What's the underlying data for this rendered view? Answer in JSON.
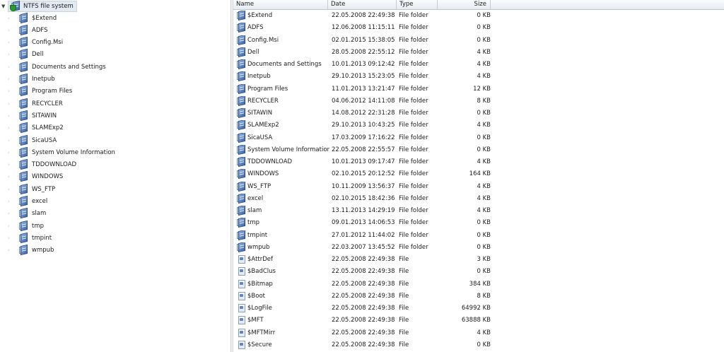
{
  "tree": {
    "root": {
      "label": "NTFS file system",
      "expander": "▼",
      "icon": "ntfs-drive-icon"
    },
    "items": [
      {
        "label": "$Extend"
      },
      {
        "label": "ADFS"
      },
      {
        "label": "Config.Msi"
      },
      {
        "label": "Dell"
      },
      {
        "label": "Documents and Settings"
      },
      {
        "label": "Inetpub"
      },
      {
        "label": "Program Files"
      },
      {
        "label": "RECYCLER"
      },
      {
        "label": "SITAWIN"
      },
      {
        "label": "SLAMExp2"
      },
      {
        "label": "SicaUSA"
      },
      {
        "label": "System Volume Information"
      },
      {
        "label": "TDDOWNLOAD"
      },
      {
        "label": "WINDOWS"
      },
      {
        "label": "WS_FTP"
      },
      {
        "label": "excel"
      },
      {
        "label": "slam"
      },
      {
        "label": "tmp"
      },
      {
        "label": "tmpint"
      },
      {
        "label": "wmpub"
      }
    ],
    "collapsed_expander": "›",
    "item_icon": "folder-drive-icon"
  },
  "list": {
    "columns": {
      "name": "Name",
      "date": "Date",
      "type": "Type",
      "size": "Size"
    },
    "rows": [
      {
        "name": "$Extend",
        "date": "22.05.2008 22:49:38",
        "type": "File folder",
        "size": "0 KB",
        "kind": "folder"
      },
      {
        "name": "ADFS",
        "date": "12.06.2008 11:15:11",
        "type": "File folder",
        "size": "0 KB",
        "kind": "folder"
      },
      {
        "name": "Config.Msi",
        "date": "02.01.2015 15:38:05",
        "type": "File folder",
        "size": "0 KB",
        "kind": "folder"
      },
      {
        "name": "Dell",
        "date": "28.05.2008 22:55:12",
        "type": "File folder",
        "size": "4 KB",
        "kind": "folder"
      },
      {
        "name": "Documents and Settings",
        "date": "10.01.2013 09:12:42",
        "type": "File folder",
        "size": "4 KB",
        "kind": "folder"
      },
      {
        "name": "Inetpub",
        "date": "29.10.2013 15:23:05",
        "type": "File folder",
        "size": "4 KB",
        "kind": "folder"
      },
      {
        "name": "Program Files",
        "date": "11.01.2013 13:21:47",
        "type": "File folder",
        "size": "12 KB",
        "kind": "folder"
      },
      {
        "name": "RECYCLER",
        "date": "04.06.2012 14:11:08",
        "type": "File folder",
        "size": "8 KB",
        "kind": "folder"
      },
      {
        "name": "SITAWIN",
        "date": "14.08.2012 22:31:28",
        "type": "File folder",
        "size": "0 KB",
        "kind": "folder"
      },
      {
        "name": "SLAMExp2",
        "date": "29.10.2013 10:43:25",
        "type": "File folder",
        "size": "4 KB",
        "kind": "folder"
      },
      {
        "name": "SicaUSA",
        "date": "17.03.2009 17:16:22",
        "type": "File folder",
        "size": "0 KB",
        "kind": "folder"
      },
      {
        "name": "System Volume Information",
        "date": "22.05.2008 22:55:57",
        "type": "File folder",
        "size": "0 KB",
        "kind": "folder"
      },
      {
        "name": "TDDOWNLOAD",
        "date": "10.01.2013 09:17:47",
        "type": "File folder",
        "size": "4 KB",
        "kind": "folder"
      },
      {
        "name": "WINDOWS",
        "date": "02.10.2015 20:12:52",
        "type": "File folder",
        "size": "164 KB",
        "kind": "folder"
      },
      {
        "name": "WS_FTP",
        "date": "10.11.2009 13:56:37",
        "type": "File folder",
        "size": "4 KB",
        "kind": "folder"
      },
      {
        "name": "excel",
        "date": "02.10.2015 18:42:36",
        "type": "File folder",
        "size": "4 KB",
        "kind": "folder"
      },
      {
        "name": "slam",
        "date": "13.11.2013 14:29:19",
        "type": "File folder",
        "size": "4 KB",
        "kind": "folder"
      },
      {
        "name": "tmp",
        "date": "09.01.2013 14:06:53",
        "type": "File folder",
        "size": "0 KB",
        "kind": "folder"
      },
      {
        "name": "tmpint",
        "date": "27.01.2012 11:44:02",
        "type": "File folder",
        "size": "0 KB",
        "kind": "folder"
      },
      {
        "name": "wmpub",
        "date": "22.03.2007 13:45:52",
        "type": "File folder",
        "size": "0 KB",
        "kind": "folder"
      },
      {
        "name": "$AttrDef",
        "date": "22.05.2008 22:49:38",
        "type": "File",
        "size": "3 KB",
        "kind": "file"
      },
      {
        "name": "$BadClus",
        "date": "22.05.2008 22:49:38",
        "type": "File",
        "size": "0 KB",
        "kind": "file"
      },
      {
        "name": "$Bitmap",
        "date": "22.05.2008 22:49:38",
        "type": "File",
        "size": "384 KB",
        "kind": "file"
      },
      {
        "name": "$Boot",
        "date": "22.05.2008 22:49:38",
        "type": "File",
        "size": "8 KB",
        "kind": "file"
      },
      {
        "name": "$LogFile",
        "date": "22.05.2008 22:49:38",
        "type": "File",
        "size": "64992 KB",
        "kind": "file"
      },
      {
        "name": "$MFT",
        "date": "22.05.2008 22:49:38",
        "type": "File",
        "size": "63888 KB",
        "kind": "file"
      },
      {
        "name": "$MFTMirr",
        "date": "22.05.2008 22:49:38",
        "type": "File",
        "size": "4 KB",
        "kind": "file"
      },
      {
        "name": "$Secure",
        "date": "22.05.2008 22:49:38",
        "type": "File",
        "size": "0 KB",
        "kind": "file"
      }
    ]
  }
}
